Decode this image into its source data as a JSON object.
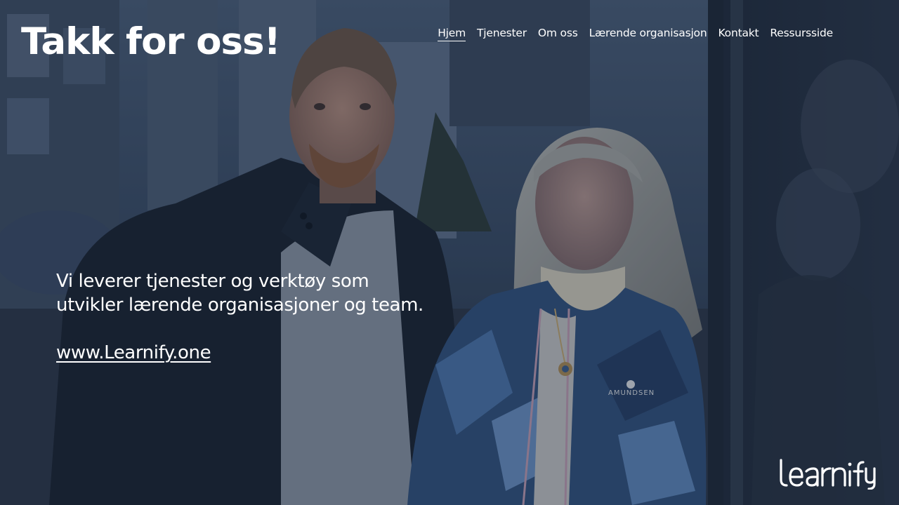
{
  "hero": {
    "title": "Takk for oss!",
    "tagline_line1": "Vi leverer tjenester og verktøy som",
    "tagline_line2": "utvikler lærende organisasjoner og team.",
    "link_text": "www.Learnify.one"
  },
  "nav": {
    "items": [
      {
        "label": "Hjem",
        "active": true
      },
      {
        "label": "Tjenester"
      },
      {
        "label": "Om oss"
      },
      {
        "label": "Lærende organisasjon"
      },
      {
        "label": "Kontakt"
      },
      {
        "label": "Ressursside"
      }
    ]
  },
  "jacket_brand": "AMUNDSEN",
  "logo": {
    "text": "learnify",
    "icon": "learnify-wordmark"
  },
  "colors": {
    "overlay": "#1b2a44",
    "text": "#ffffff",
    "jacket_blue": "#3f6fa8",
    "jacket_dark": "#1d2a44"
  }
}
